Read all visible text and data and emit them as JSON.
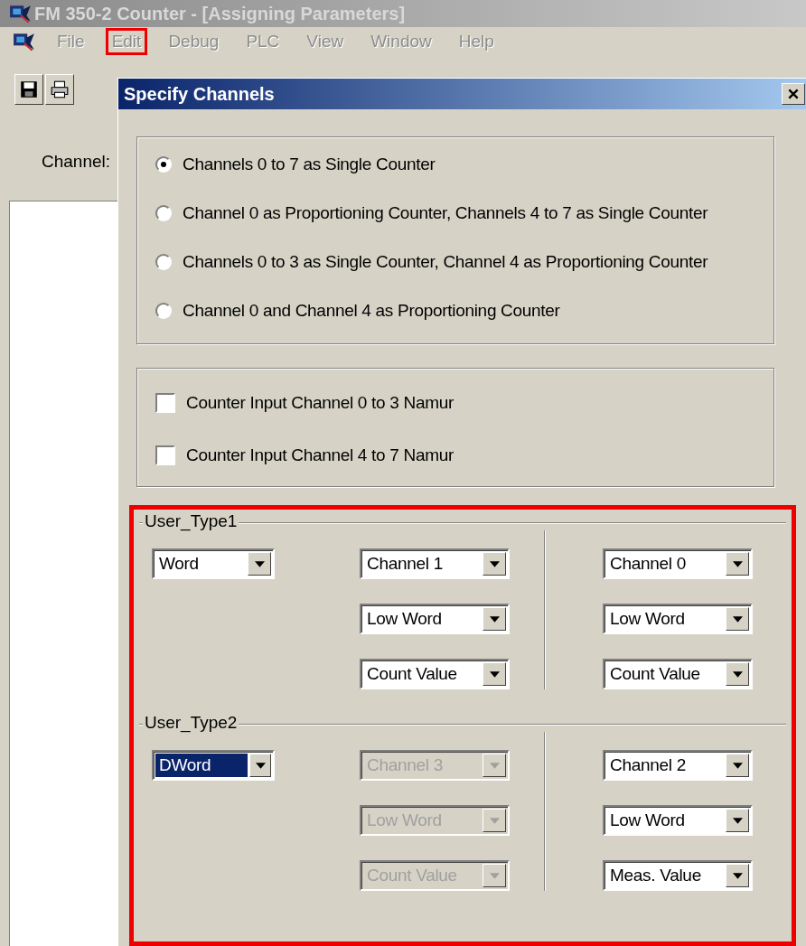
{
  "window": {
    "title": "FM 350-2 Counter - [Assigning Parameters]",
    "menu": [
      {
        "label": "File",
        "disabled": true,
        "highlighted": false
      },
      {
        "label": "Edit",
        "disabled": true,
        "highlighted": true
      },
      {
        "label": "Debug",
        "disabled": true,
        "highlighted": false
      },
      {
        "label": "PLC",
        "disabled": true,
        "highlighted": false
      },
      {
        "label": "View",
        "disabled": true,
        "highlighted": false
      },
      {
        "label": "Window",
        "disabled": true,
        "highlighted": false
      },
      {
        "label": "Help",
        "disabled": true,
        "highlighted": false
      }
    ],
    "channel_label": "Channel:"
  },
  "dialog": {
    "title": "Specify Channels",
    "channel_modes": [
      {
        "label": "Channels 0 to 7 as Single Counter",
        "selected": true
      },
      {
        "label": "Channel 0 as Proportioning Counter, Channels 4 to 7 as Single Counter",
        "selected": false
      },
      {
        "label": "Channels 0 to 3 as Single Counter, Channel 4 as Proportioning Counter",
        "selected": false
      },
      {
        "label": "Channel 0 and Channel 4 as Proportioning Counter",
        "selected": false
      }
    ],
    "namur_options": [
      {
        "label": "Counter Input Channel 0 to 3 Namur",
        "checked": false
      },
      {
        "label": "Counter Input Channel 4 to 7 Namur",
        "checked": false
      }
    ],
    "user_types": {
      "highlighted": true,
      "groups": [
        {
          "title": "User_Type1",
          "type": {
            "value": "Word",
            "selected": false
          },
          "left": [
            {
              "value": "Channel 1",
              "disabled": false
            },
            {
              "value": "Low Word",
              "disabled": false
            },
            {
              "value": "Count Value",
              "disabled": false
            }
          ],
          "right": [
            {
              "value": "Channel 0",
              "disabled": false
            },
            {
              "value": "Low Word",
              "disabled": false
            },
            {
              "value": "Count Value",
              "disabled": false
            }
          ]
        },
        {
          "title": "User_Type2",
          "type": {
            "value": "DWord",
            "selected": true
          },
          "left": [
            {
              "value": "Channel 3",
              "disabled": true
            },
            {
              "value": "Low Word",
              "disabled": true
            },
            {
              "value": "Count Value",
              "disabled": true
            }
          ],
          "right": [
            {
              "value": "Channel 2",
              "disabled": false
            },
            {
              "value": "Low Word",
              "disabled": false
            },
            {
              "value": "Meas. Value",
              "disabled": false
            }
          ]
        }
      ]
    }
  }
}
